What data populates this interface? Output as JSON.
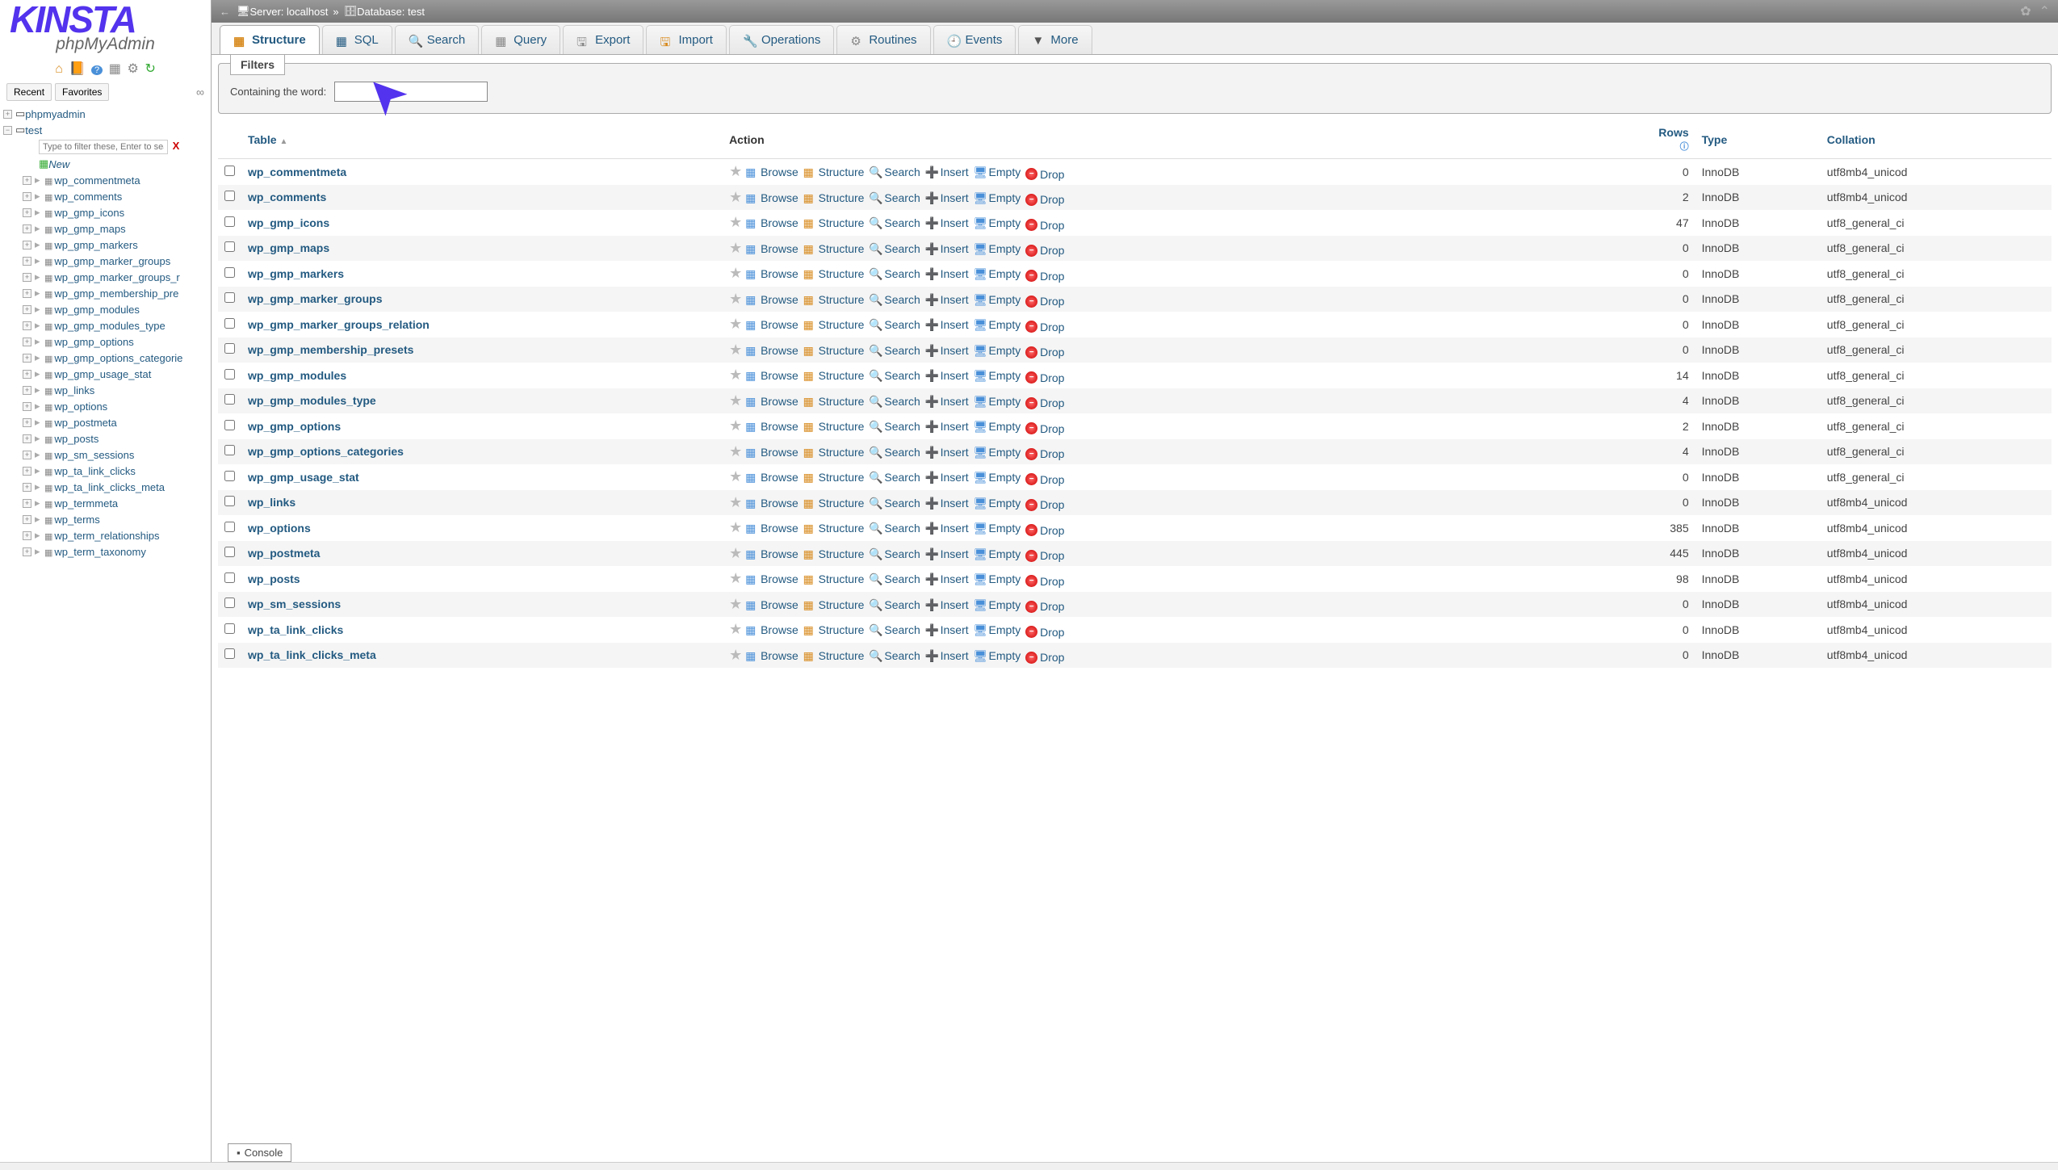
{
  "logo": {
    "main": "KINSTA",
    "sub": "phpMyAdmin"
  },
  "sidebar": {
    "recent": "Recent",
    "favorites": "Favorites",
    "root": "phpmyadmin",
    "db": "test",
    "filter_placeholder": "Type to filter these, Enter to search",
    "new": "New",
    "tables": [
      "wp_commentmeta",
      "wp_comments",
      "wp_gmp_icons",
      "wp_gmp_maps",
      "wp_gmp_markers",
      "wp_gmp_marker_groups",
      "wp_gmp_marker_groups_r",
      "wp_gmp_membership_pre",
      "wp_gmp_modules",
      "wp_gmp_modules_type",
      "wp_gmp_options",
      "wp_gmp_options_categorie",
      "wp_gmp_usage_stat",
      "wp_links",
      "wp_options",
      "wp_postmeta",
      "wp_posts",
      "wp_sm_sessions",
      "wp_ta_link_clicks",
      "wp_ta_link_clicks_meta",
      "wp_termmeta",
      "wp_terms",
      "wp_term_relationships",
      "wp_term_taxonomy"
    ]
  },
  "breadcrumb": {
    "server_label": "Server:",
    "server": "localhost",
    "db_label": "Database:",
    "db": "test"
  },
  "tabs": {
    "structure": "Structure",
    "sql": "SQL",
    "search": "Search",
    "query": "Query",
    "export": "Export",
    "import": "Import",
    "operations": "Operations",
    "routines": "Routines",
    "events": "Events",
    "more": "More"
  },
  "filters": {
    "legend": "Filters",
    "label": "Containing the word:"
  },
  "table_headers": {
    "table": "Table",
    "action": "Action",
    "rows": "Rows",
    "type": "Type",
    "collation": "Collation"
  },
  "actions": {
    "browse": "Browse",
    "structure": "Structure",
    "search": "Search",
    "insert": "Insert",
    "empty": "Empty",
    "drop": "Drop"
  },
  "console": "Console",
  "rows": [
    {
      "name": "wp_commentmeta",
      "rows": "0",
      "type": "InnoDB",
      "collation": "utf8mb4_unicod"
    },
    {
      "name": "wp_comments",
      "rows": "2",
      "type": "InnoDB",
      "collation": "utf8mb4_unicod"
    },
    {
      "name": "wp_gmp_icons",
      "rows": "47",
      "type": "InnoDB",
      "collation": "utf8_general_ci"
    },
    {
      "name": "wp_gmp_maps",
      "rows": "0",
      "type": "InnoDB",
      "collation": "utf8_general_ci"
    },
    {
      "name": "wp_gmp_markers",
      "rows": "0",
      "type": "InnoDB",
      "collation": "utf8_general_ci"
    },
    {
      "name": "wp_gmp_marker_groups",
      "rows": "0",
      "type": "InnoDB",
      "collation": "utf8_general_ci"
    },
    {
      "name": "wp_gmp_marker_groups_relation",
      "rows": "0",
      "type": "InnoDB",
      "collation": "utf8_general_ci"
    },
    {
      "name": "wp_gmp_membership_presets",
      "rows": "0",
      "type": "InnoDB",
      "collation": "utf8_general_ci"
    },
    {
      "name": "wp_gmp_modules",
      "rows": "14",
      "type": "InnoDB",
      "collation": "utf8_general_ci"
    },
    {
      "name": "wp_gmp_modules_type",
      "rows": "4",
      "type": "InnoDB",
      "collation": "utf8_general_ci"
    },
    {
      "name": "wp_gmp_options",
      "rows": "2",
      "type": "InnoDB",
      "collation": "utf8_general_ci"
    },
    {
      "name": "wp_gmp_options_categories",
      "rows": "4",
      "type": "InnoDB",
      "collation": "utf8_general_ci"
    },
    {
      "name": "wp_gmp_usage_stat",
      "rows": "0",
      "type": "InnoDB",
      "collation": "utf8_general_ci"
    },
    {
      "name": "wp_links",
      "rows": "0",
      "type": "InnoDB",
      "collation": "utf8mb4_unicod"
    },
    {
      "name": "wp_options",
      "rows": "385",
      "type": "InnoDB",
      "collation": "utf8mb4_unicod"
    },
    {
      "name": "wp_postmeta",
      "rows": "445",
      "type": "InnoDB",
      "collation": "utf8mb4_unicod"
    },
    {
      "name": "wp_posts",
      "rows": "98",
      "type": "InnoDB",
      "collation": "utf8mb4_unicod"
    },
    {
      "name": "wp_sm_sessions",
      "rows": "0",
      "type": "InnoDB",
      "collation": "utf8mb4_unicod"
    },
    {
      "name": "wp_ta_link_clicks",
      "rows": "0",
      "type": "InnoDB",
      "collation": "utf8mb4_unicod"
    },
    {
      "name": "wp_ta_link_clicks_meta",
      "rows": "0",
      "type": "InnoDB",
      "collation": "utf8mb4_unicod"
    }
  ]
}
